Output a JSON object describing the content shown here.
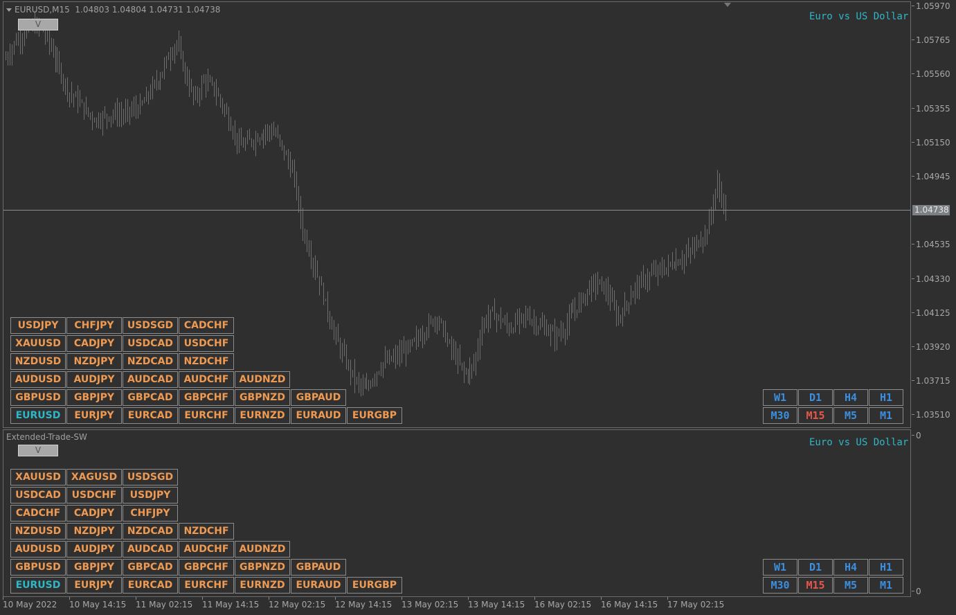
{
  "header": {
    "symbol_timeframe": "EURUSD,M15",
    "ohlc": "1.04803 1.04804 1.04731 1.04738"
  },
  "indicator_name": "Extended-Trade-SW",
  "caption": "Euro vs US Dollar",
  "toggle_label": "V",
  "current_price": "1.04738",
  "price_axis": [
    "1.05970",
    "1.05765",
    "1.05560",
    "1.05355",
    "1.05150",
    "1.04945",
    "1.04535",
    "1.04330",
    "1.04125",
    "1.03920",
    "1.03715",
    "1.03510"
  ],
  "sub_axis": [
    "0",
    "0"
  ],
  "time_axis": [
    "10 May 2022",
    "10 May 14:15",
    "11 May 02:15",
    "11 May 14:15",
    "12 May 02:15",
    "12 May 14:15",
    "13 May 02:15",
    "13 May 14:15",
    "16 May 02:15",
    "16 May 14:15",
    "17 May 02:15"
  ],
  "main_symbols": [
    [
      "USDJPY",
      "CHFJPY",
      "USDSGD",
      "CADCHF"
    ],
    [
      "XAUUSD",
      "CADJPY",
      "USDCAD",
      "USDCHF"
    ],
    [
      "NZDUSD",
      "NZDJPY",
      "NZDCAD",
      "NZDCHF"
    ],
    [
      "AUDUSD",
      "AUDJPY",
      "AUDCAD",
      "AUDCHF",
      "AUDNZD"
    ],
    [
      "GBPUSD",
      "GBPJPY",
      "GBPCAD",
      "GBPCHF",
      "GBPNZD",
      "GBPAUD"
    ],
    [
      "EURUSD",
      "EURJPY",
      "EURCAD",
      "EURCHF",
      "EURNZD",
      "EURAUD",
      "EURGBP"
    ]
  ],
  "sub_symbols": [
    [
      "XAUUSD",
      "XAGUSD",
      "USDSGD"
    ],
    [
      "USDCAD",
      "USDCHF",
      "USDJPY"
    ],
    [
      "CADCHF",
      "CADJPY",
      "CHFJPY"
    ],
    [
      "NZDUSD",
      "NZDJPY",
      "NZDCAD",
      "NZDCHF"
    ],
    [
      "AUDUSD",
      "AUDJPY",
      "AUDCAD",
      "AUDCHF",
      "AUDNZD"
    ],
    [
      "GBPUSD",
      "GBPJPY",
      "GBPCAD",
      "GBPCHF",
      "GBPNZD",
      "GBPAUD"
    ],
    [
      "EURUSD",
      "EURJPY",
      "EURCAD",
      "EURCHF",
      "EURNZD",
      "EURAUD",
      "EURGBP"
    ]
  ],
  "active_symbol": "EURUSD",
  "timeframes": [
    [
      "W1",
      "D1",
      "H4",
      "H1"
    ],
    [
      "M30",
      "M15",
      "M5",
      "M1"
    ]
  ],
  "active_timeframe": "M15",
  "colors": {
    "background": "#2f2f2f",
    "candle": "#6e6e6e",
    "symbol": "#ef9a52",
    "active": "#2fb7c7",
    "timeframe": "#3c8fe0",
    "active_timeframe": "#e8564a"
  },
  "chart_data": {
    "type": "line",
    "series": [
      {
        "values": [
          1.0565,
          1.0575,
          1.058,
          1.0585,
          1.0583,
          1.0572,
          1.0558,
          1.0545,
          1.054,
          1.0533,
          1.0528,
          1.053,
          1.0532,
          1.0531,
          1.0534,
          1.0536,
          1.0545,
          1.0553,
          1.0565,
          1.0575,
          1.0555,
          1.054,
          1.0552,
          1.0548,
          1.0538,
          1.0525,
          1.0512,
          1.0515,
          1.0518,
          1.0522,
          1.052,
          1.0508,
          1.0495,
          1.0462,
          1.0445,
          1.0428,
          1.0408,
          1.0392,
          1.038,
          1.037,
          1.0365,
          1.0375,
          1.0382,
          1.0384,
          1.0388,
          1.0392,
          1.0398,
          1.0405,
          1.041,
          1.0395,
          1.0385,
          1.0375,
          1.038,
          1.0405,
          1.0412,
          1.0408,
          1.0402,
          1.0408,
          1.041,
          1.0405,
          1.0402,
          1.0398,
          1.0402,
          1.0412,
          1.042,
          1.0428,
          1.043,
          1.0423,
          1.0408,
          1.0418,
          1.0428,
          1.0432,
          1.0436,
          1.0438,
          1.0442,
          1.0444,
          1.0448,
          1.0455,
          1.0462,
          1.049,
          1.0474
        ]
      }
    ]
  }
}
